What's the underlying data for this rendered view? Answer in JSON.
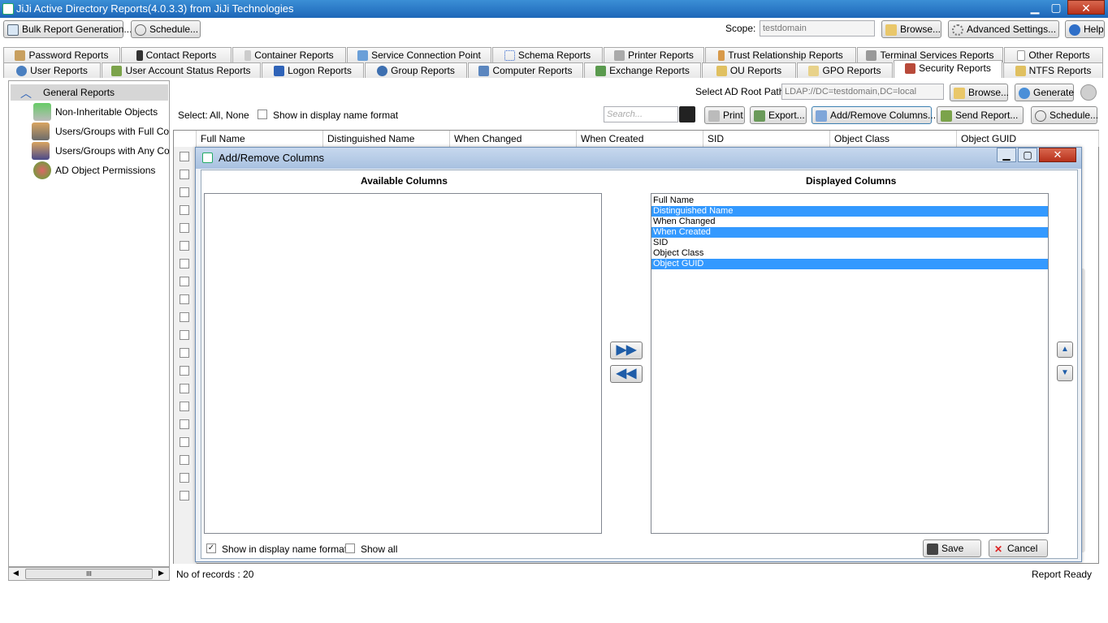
{
  "window": {
    "title": "JiJi Active Directory Reports(4.0.3.3) from JiJi Technologies",
    "minimize": "▁",
    "maximize": "▢",
    "close": "✕"
  },
  "toolbar": {
    "bulk_report": "Bulk Report Generation...",
    "schedule": "Schedule...",
    "scope_label": "Scope:",
    "scope_value": "testdomain",
    "browse": "Browse...",
    "advanced_settings": "Advanced Settings...",
    "help": "Help"
  },
  "tabs_top": [
    "Password Reports",
    "Contact Reports",
    "Container Reports",
    "Service Connection Point",
    "Schema Reports",
    "Printer Reports",
    "Trust Relationship Reports",
    "Terminal Services Reports",
    "Other Reports"
  ],
  "tabs_bottom": [
    "User Reports",
    "User Account Status Reports",
    "Logon Reports",
    "Group Reports",
    "Computer Reports",
    "Exchange Reports",
    "OU Reports",
    "GPO Reports",
    "Security Reports",
    "NTFS Reports"
  ],
  "tree": {
    "header": "General Reports",
    "items": [
      "Non-Inheritable Objects",
      "Users/Groups with Full Control",
      "Users/Groups with Any Control",
      "AD Object Permissions"
    ]
  },
  "main": {
    "root_path_label": "Select AD Root Path:",
    "root_path_value": "LDAP://DC=testdomain,DC=local",
    "browse": "Browse...",
    "generate": "Generate",
    "select_label": "Select:",
    "select_all": "All,",
    "select_none": "None",
    "show_display_name": "Show in display name format",
    "search_placeholder": "Search...",
    "print": "Print",
    "export": "Export...",
    "add_remove_columns": "Add/Remove Columns...",
    "send_report": "Send Report...",
    "schedule": "Schedule...",
    "columns": [
      "Full Name",
      "Distinguished Name",
      "When Changed",
      "When Created",
      "SID",
      "Object Class",
      "Object GUID"
    ],
    "records": "No of records : 20",
    "status": "Report Ready"
  },
  "dialog": {
    "title": "Add/Remove Columns",
    "available_label": "Available Columns",
    "displayed_label": "Displayed Columns",
    "available": [],
    "displayed": [
      {
        "label": "Full Name",
        "selected": false
      },
      {
        "label": "Distinguished Name",
        "selected": true
      },
      {
        "label": "When Changed",
        "selected": false
      },
      {
        "label": "When Created",
        "selected": true
      },
      {
        "label": "SID",
        "selected": false
      },
      {
        "label": "Object Class",
        "selected": false
      },
      {
        "label": "Object GUID",
        "selected": true
      }
    ],
    "show_display_name": "Show in display name format",
    "show_all": "Show all",
    "save": "Save",
    "cancel": "Cancel",
    "move_right": "▶▶",
    "move_left": "◀◀",
    "move_up": "▲",
    "move_down": "▼",
    "scroll_thumb": "III"
  },
  "colors": {
    "accent": "#3399ff",
    "title_bar": "#1d66b8"
  }
}
